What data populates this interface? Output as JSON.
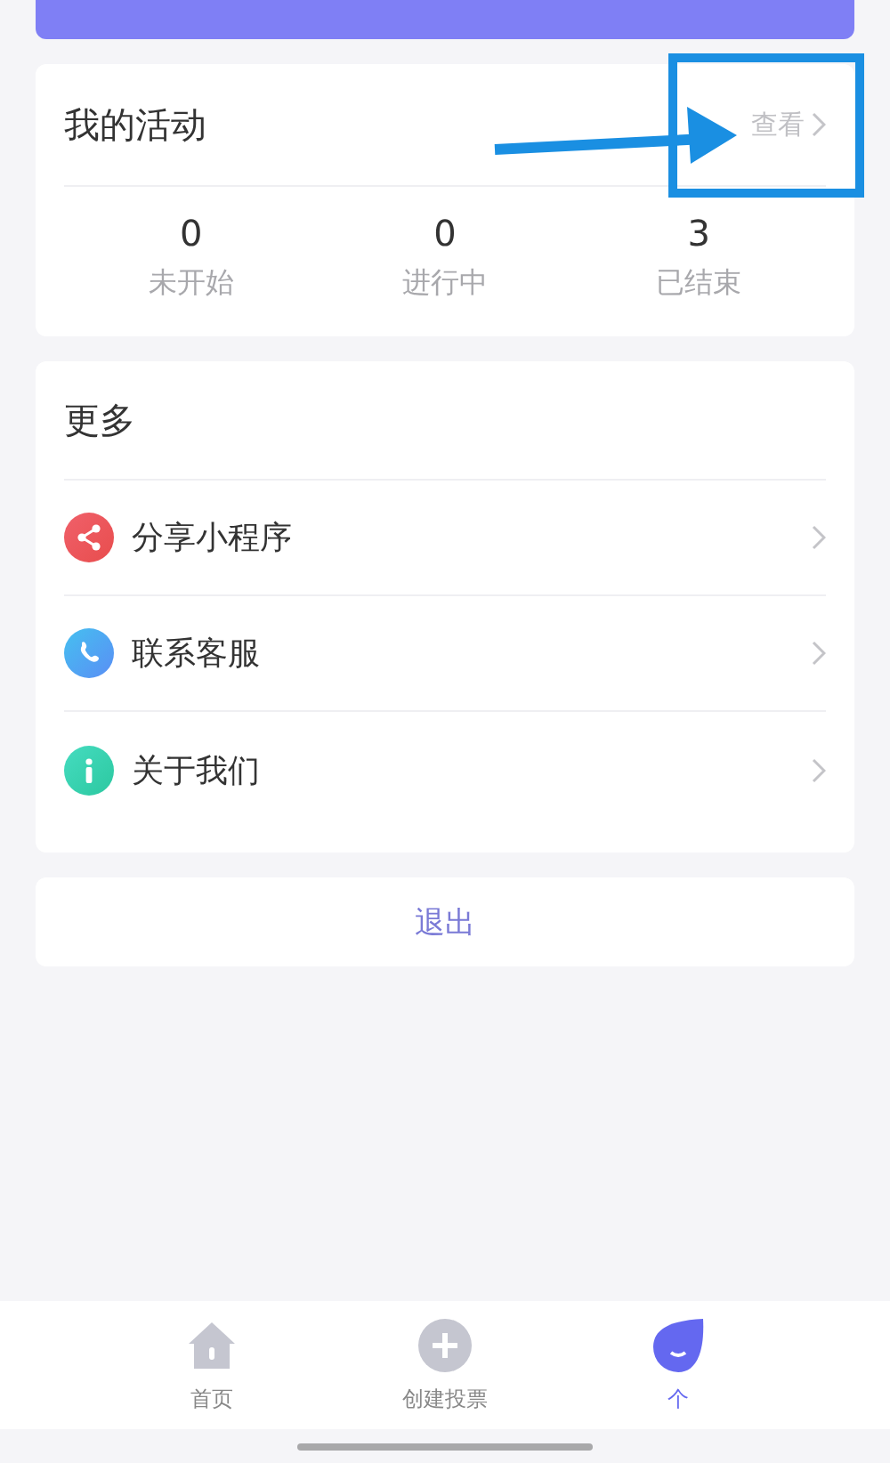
{
  "activity": {
    "title": "我的活动",
    "link": "查看",
    "stats": [
      {
        "value": "0",
        "label": "未开始"
      },
      {
        "value": "0",
        "label": "进行中"
      },
      {
        "value": "3",
        "label": "已结束"
      }
    ]
  },
  "more": {
    "title": "更多",
    "items": [
      {
        "label": "分享小程序"
      },
      {
        "label": "联系客服"
      },
      {
        "label": "关于我们"
      }
    ]
  },
  "logout": "退出",
  "tabs": [
    {
      "label": "首页",
      "selected": false
    },
    {
      "label": "创建投票",
      "selected": false
    },
    {
      "label": "个",
      "selected": true
    }
  ]
}
